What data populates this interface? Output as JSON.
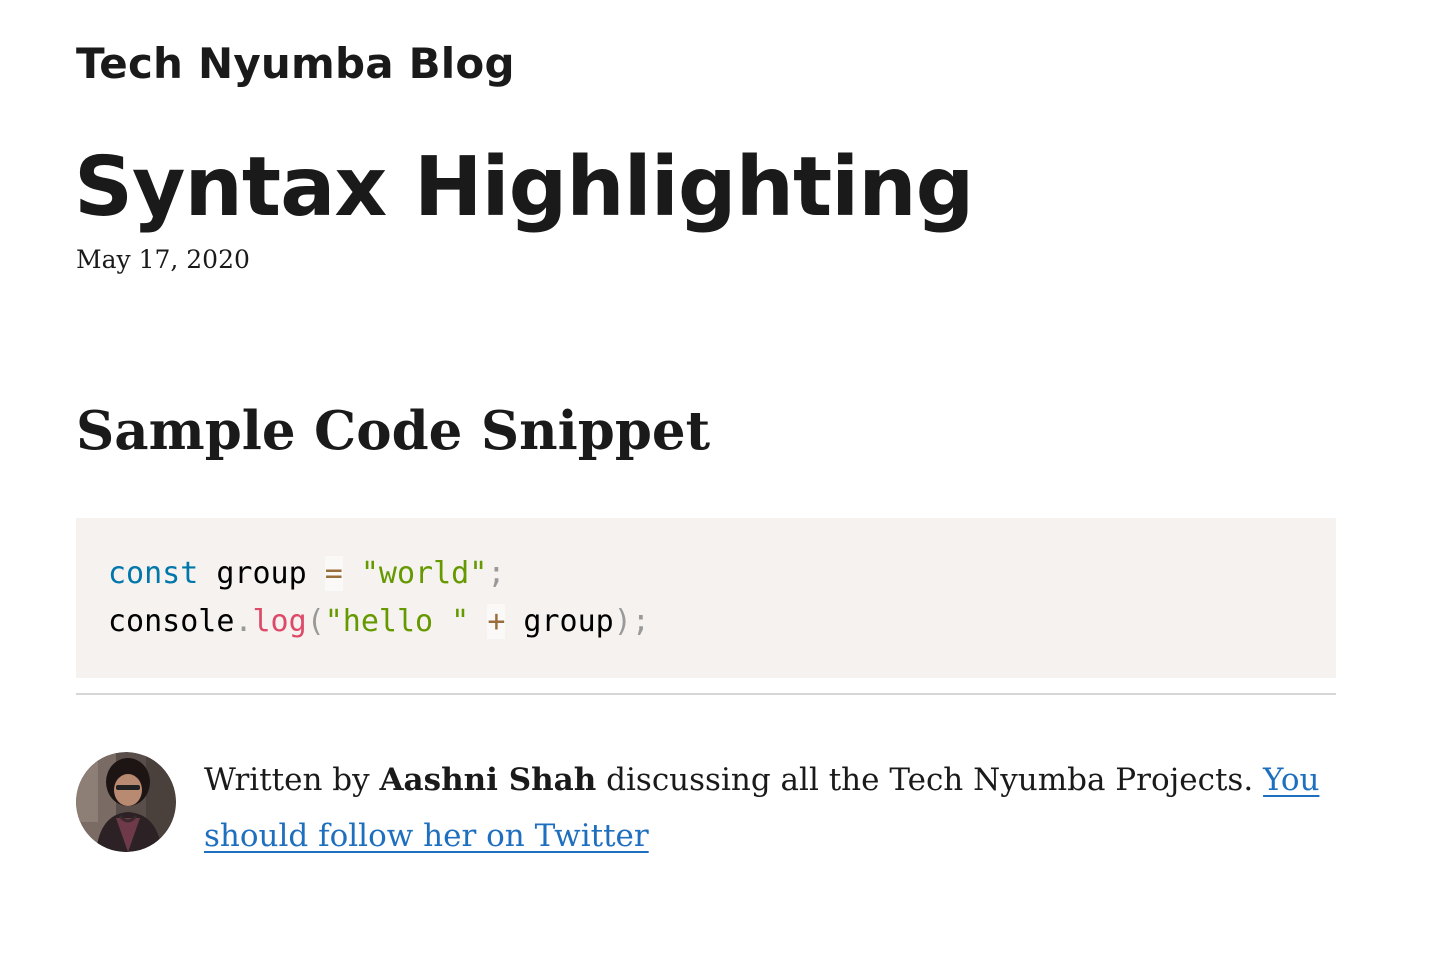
{
  "site": {
    "title": "Tech Nyumba Blog"
  },
  "post": {
    "title": "Syntax Highlighting",
    "date": "May 17, 2020"
  },
  "section": {
    "heading": "Sample Code Snippet"
  },
  "code": {
    "language": "javascript",
    "lines": [
      [
        {
          "text": "const",
          "type": "keyword"
        },
        {
          "text": " group ",
          "type": "plain"
        },
        {
          "text": "=",
          "type": "operator"
        },
        {
          "text": " ",
          "type": "plain"
        },
        {
          "text": "\"world\"",
          "type": "string"
        },
        {
          "text": ";",
          "type": "punct"
        }
      ],
      [
        {
          "text": "console",
          "type": "plain"
        },
        {
          "text": ".",
          "type": "punct"
        },
        {
          "text": "log",
          "type": "function"
        },
        {
          "text": "(",
          "type": "punct"
        },
        {
          "text": "\"hello \"",
          "type": "string"
        },
        {
          "text": " ",
          "type": "plain"
        },
        {
          "text": "+",
          "type": "operator"
        },
        {
          "text": " group",
          "type": "plain"
        },
        {
          "text": ")",
          "type": "punct"
        },
        {
          "text": ";",
          "type": "punct"
        }
      ]
    ],
    "colors": {
      "background": "#f5f2f0",
      "keyword": "#0077aa",
      "operator": "#9a6e3a",
      "string": "#669900",
      "punct": "#999999",
      "function": "#dd4a68",
      "plain": "#000000"
    }
  },
  "author": {
    "avatar_icon": "author-photo",
    "prefix": "Written by ",
    "name": "Aashni Shah",
    "suffix": " discussing all the Tech Nyumba Projects. ",
    "link_text": "You should follow her on Twitter",
    "link_color": "#1f6fbf"
  }
}
